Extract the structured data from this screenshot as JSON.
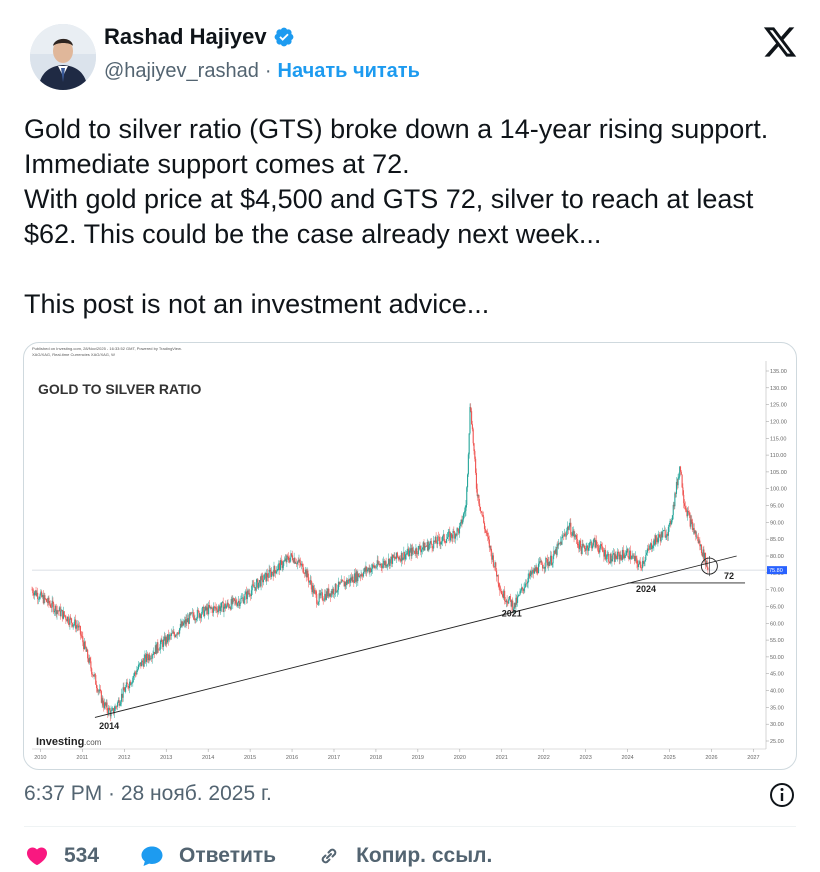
{
  "author": {
    "name": "Rashad Hajiyev",
    "handle": "@hajiyev_rashad",
    "separator": "·",
    "follow_label": "Начать читать"
  },
  "tweet": {
    "text": "Gold to silver ratio (GTS) broke down a 14-year rising support. Immediate support comes at 72.\nWith gold price at $4,500 and GTS 72, silver to reach at least $62. This could be the case already next week...\n\nThis post is not an investment advice..."
  },
  "chart_image": {
    "header_line1": "Published on Investing.com, 28/Nov/2025 - 16:33:52 GMT, Powered by TradingView.",
    "header_line2": "XAG/XAG, Real-time Currencies XAG/XAG, W",
    "title": "GOLD TO SILVER RATIO",
    "watermark_main": "Investing",
    "watermark_sub": ".com",
    "current_value_badge": "75.80",
    "annotations": [
      "2014",
      "2021",
      "2024",
      "72"
    ]
  },
  "chart_data": {
    "type": "line",
    "title": "GOLD TO SILVER RATIO",
    "xlabel": "",
    "ylabel": "",
    "x_ticks": [
      "2010",
      "2011",
      "2012",
      "2013",
      "2014",
      "2015",
      "2016",
      "2017",
      "2018",
      "2019",
      "2020",
      "2021",
      "2022",
      "2023",
      "2024",
      "2025",
      "2026",
      "2027"
    ],
    "y_ticks": [
      "135.00",
      "130.00",
      "125.00",
      "120.00",
      "115.00",
      "110.00",
      "105.00",
      "100.00",
      "95.00",
      "90.00",
      "85.00",
      "80.00",
      "75.00",
      "70.00",
      "65.00",
      "60.00",
      "55.00",
      "50.00",
      "45.00",
      "40.00",
      "35.00",
      "30.00",
      "25.00"
    ],
    "ylim": [
      25,
      135
    ],
    "xlim": [
      2009.8,
      2027.3
    ],
    "series": [
      {
        "x": [
          2009.8,
          2010.2,
          2010.5,
          2010.9,
          2011.2,
          2011.5,
          2011.7,
          2012.0,
          2012.4,
          2012.8,
          2013.2,
          2013.6,
          2014.0,
          2014.4,
          2014.8,
          2015.2,
          2015.6,
          2016.0,
          2016.3,
          2016.6,
          2017.0,
          2017.4,
          2017.8,
          2018.2,
          2018.6,
          2019.0,
          2019.4,
          2019.8,
          2020.0,
          2020.15,
          2020.25,
          2020.4,
          2020.6,
          2021.0,
          2021.3,
          2021.6,
          2021.9,
          2022.2,
          2022.6,
          2022.9,
          2023.2,
          2023.6,
          2024.0,
          2024.3,
          2024.6,
          2025.0,
          2025.25,
          2025.35,
          2025.5,
          2025.7,
          2025.85,
          2025.92
        ],
        "y": [
          70,
          66,
          63,
          59,
          47,
          36,
          33,
          40,
          48,
          53,
          57,
          62,
          64,
          65,
          67,
          72,
          76,
          80,
          76,
          67,
          70,
          73,
          76,
          78,
          80,
          82,
          84,
          86,
          88,
          95,
          126,
          100,
          88,
          69,
          65,
          73,
          77,
          79,
          89,
          82,
          84,
          79,
          81,
          77,
          84,
          88,
          107,
          96,
          90,
          84,
          79,
          76
        ]
      }
    ],
    "support_lines": [
      {
        "name": "14-year rising support",
        "from": [
          2011.3,
          32
        ],
        "to": [
          2026.6,
          80
        ]
      },
      {
        "name": "Immediate support",
        "from": [
          2024.0,
          72
        ],
        "to": [
          2026.8,
          72
        ]
      }
    ],
    "current_value": 75.8,
    "grid": false,
    "legend": "none"
  },
  "meta": {
    "timestamp": "6:37 PM · 28 нояб. 2025 г."
  },
  "actions": {
    "likes": "534",
    "reply_label": "Ответить",
    "copy_label": "Копир. ссыл."
  },
  "colors": {
    "accent": "#1d9bf0",
    "like": "#f91880",
    "muted": "#536471",
    "up_candle": "#26a69a",
    "down_candle": "#ef5350"
  }
}
